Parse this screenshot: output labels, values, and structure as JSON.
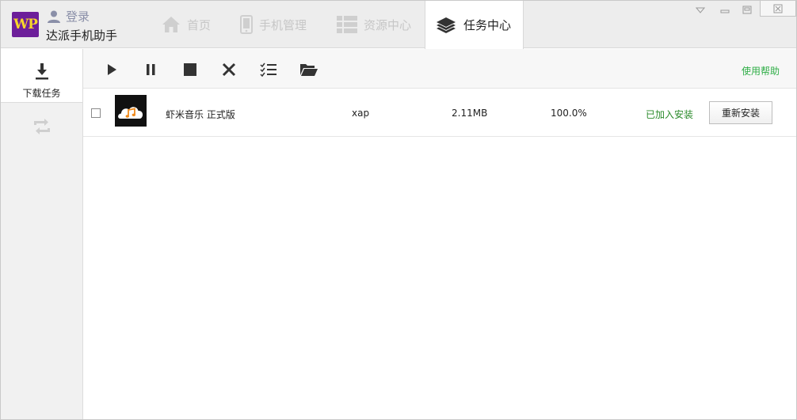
{
  "header": {
    "logo_text": "WP",
    "login_label": "登录",
    "app_name": "达派手机助手",
    "tabs": [
      {
        "label": "首页",
        "icon": "home-icon",
        "active": false
      },
      {
        "label": "手机管理",
        "icon": "phone-icon",
        "active": false
      },
      {
        "label": "资源中心",
        "icon": "grid-list-icon",
        "active": false
      },
      {
        "label": "任务中心",
        "icon": "layers-icon",
        "active": true
      }
    ],
    "window_controls": [
      "dropdown-icon",
      "minimize-icon",
      "maximize-icon",
      "close-icon"
    ]
  },
  "sidebar": {
    "items": [
      {
        "label": "下载任务",
        "icon": "download-icon",
        "active": true
      },
      {
        "label": "",
        "icon": "sync-icon",
        "active": false
      }
    ]
  },
  "toolbar": {
    "buttons": [
      "play-icon",
      "pause-icon",
      "stop-icon",
      "delete-icon",
      "checklist-icon",
      "folder-open-icon"
    ],
    "help_label": "使用帮助"
  },
  "tasks": [
    {
      "checked": false,
      "icon": "xiami-music-icon",
      "name": "虾米音乐 正式版",
      "type": "xap",
      "size": "2.11MB",
      "progress": "100.0%",
      "status": "已加入安装",
      "action_label": "重新安装"
    }
  ],
  "colors": {
    "accent_green": "#2fae47",
    "status_green": "#2a8a2a",
    "logo_bg": "#6d1f9a",
    "logo_fg": "#f7d62a",
    "icon_orange": "#f08a1c"
  }
}
